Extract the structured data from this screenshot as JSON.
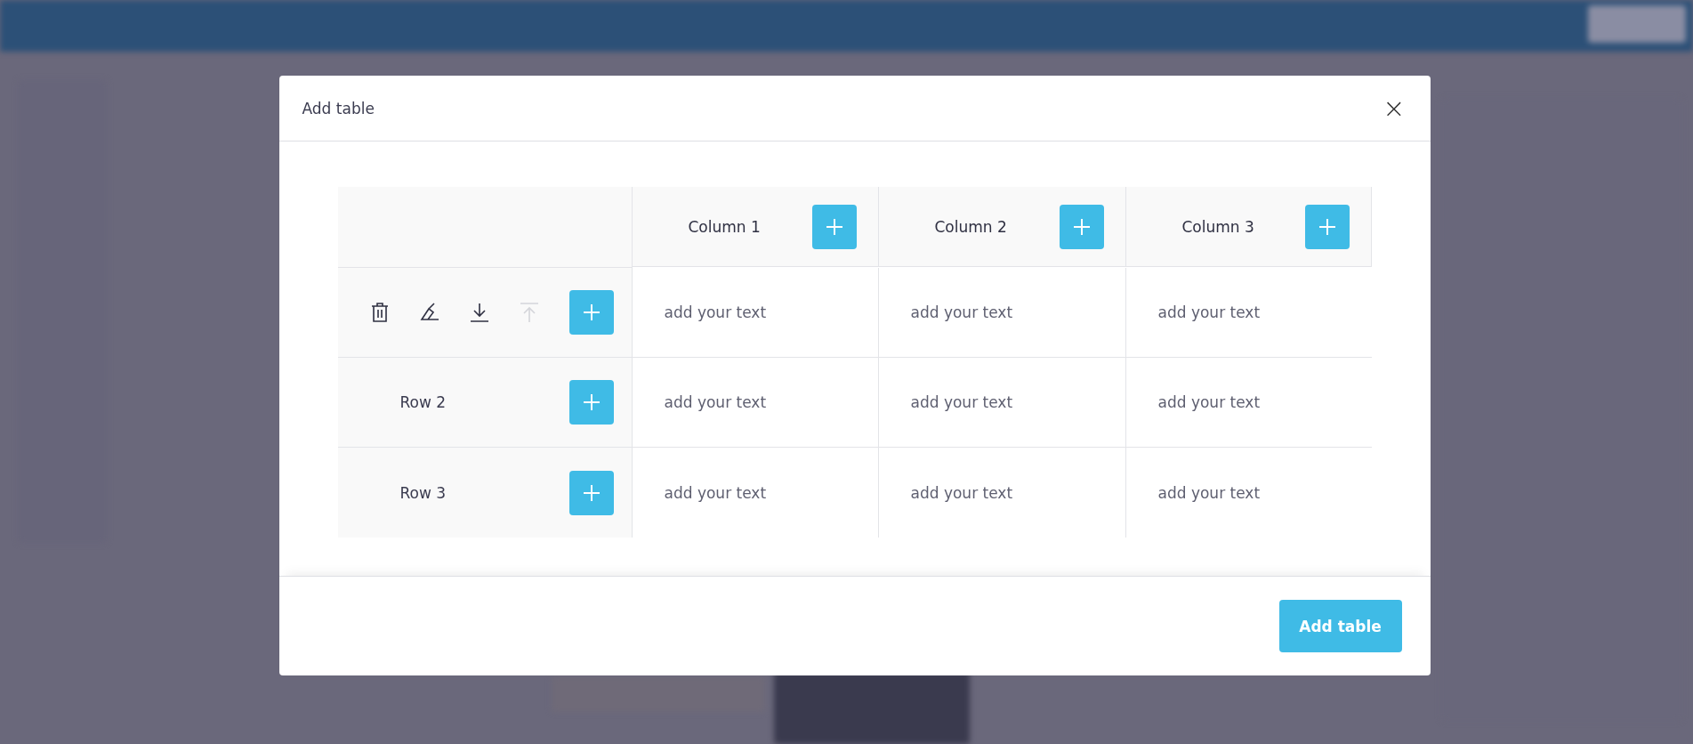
{
  "dialog": {
    "title": "Add table",
    "close_label": "×",
    "table": {
      "columns": [
        {
          "label": "Column 1"
        },
        {
          "label": "Column 2"
        },
        {
          "label": "Column 3"
        }
      ],
      "rows": [
        {
          "kind": "actions",
          "actions": [
            {
              "kind": "delete",
              "disabled": false
            },
            {
              "kind": "clear",
              "disabled": false
            },
            {
              "kind": "move-down",
              "disabled": false
            },
            {
              "kind": "move-up",
              "disabled": true
            }
          ],
          "cells": [
            {
              "placeholder": "add your text"
            },
            {
              "placeholder": "add your text"
            },
            {
              "placeholder": "add your text"
            }
          ]
        },
        {
          "kind": "label",
          "label": "Row 2",
          "cells": [
            {
              "placeholder": "add your text"
            },
            {
              "placeholder": "add your text"
            },
            {
              "placeholder": "add your text"
            }
          ]
        },
        {
          "kind": "label",
          "label": "Row 3",
          "cells": [
            {
              "placeholder": "add your text"
            },
            {
              "placeholder": "add your text"
            },
            {
              "placeholder": "add your text"
            }
          ]
        }
      ]
    },
    "submit": "Add table"
  }
}
